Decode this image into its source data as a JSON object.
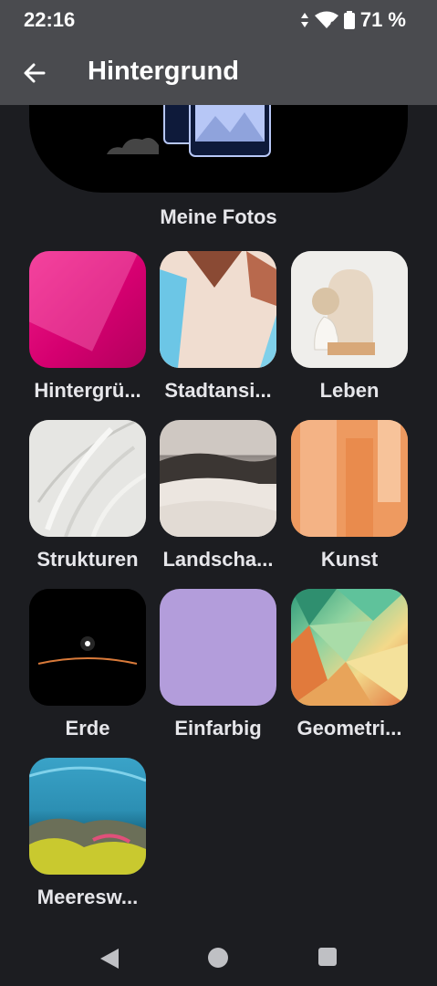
{
  "status": {
    "time": "22:16",
    "battery": "71 %"
  },
  "appbar": {
    "title": "Hintergrund"
  },
  "hero": {
    "label": "Meine Fotos"
  },
  "categories": [
    {
      "label": "Hintergrü..."
    },
    {
      "label": "Stadtansi..."
    },
    {
      "label": "Leben"
    },
    {
      "label": "Strukturen"
    },
    {
      "label": "Landscha..."
    },
    {
      "label": "Kunst"
    },
    {
      "label": "Erde"
    },
    {
      "label": "Einfarbig"
    },
    {
      "label": "Geometri..."
    },
    {
      "label": "Meeresw..."
    }
  ],
  "colors": {
    "solid_swatch": "#b39ddb",
    "accent_photo": "#b7c7f6"
  }
}
